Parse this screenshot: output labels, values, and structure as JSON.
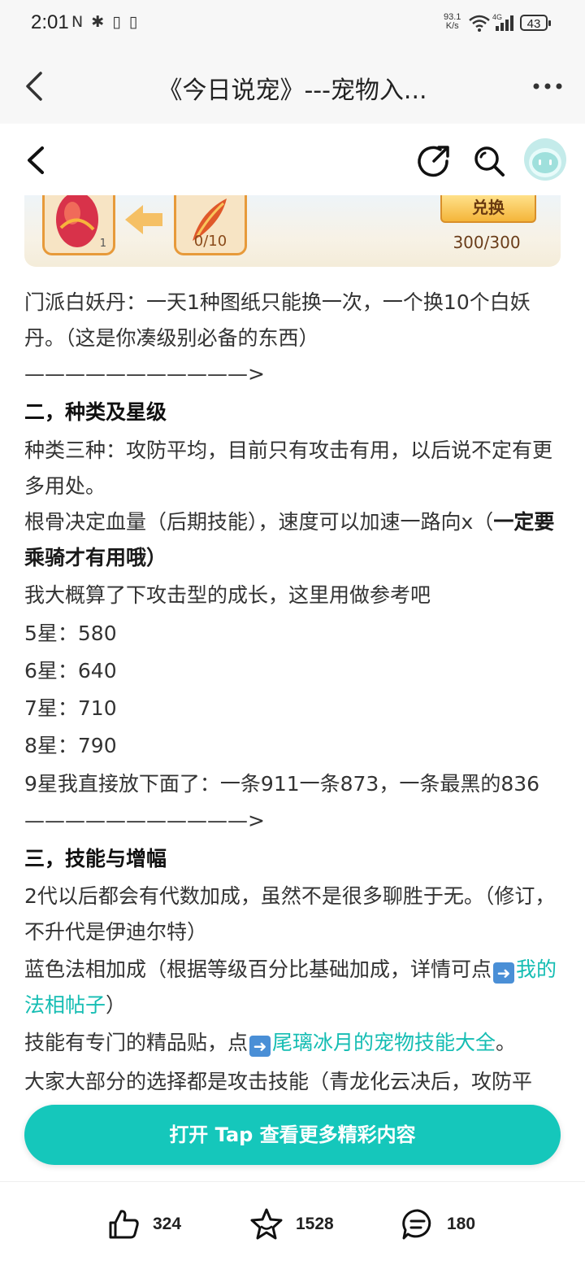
{
  "status_bar": {
    "time": "2:01",
    "left_icons": "N ✱ ▯ ▯",
    "speed_value": "93.1",
    "speed_unit": "K/s",
    "network": "4G",
    "battery": "43"
  },
  "title_bar": {
    "title": "《今日说宠》---宠物入..."
  },
  "banner": {
    "slot1_count": "1",
    "slot2_fraction": "0/10",
    "exchange_label": "兑换",
    "exchange_count": "300/300"
  },
  "article": {
    "p1": "门派白妖丹：一天1种图纸只能换一次，一个换10个白妖丹。（这是你凑级别必备的东西）",
    "divider1": "———————————>",
    "h2": "二，种类及星级",
    "p2": "种类三种：攻防平均，目前只有攻击有用，以后说不定有更多用处。",
    "p3_a": "根骨决定血量（后期技能），速度可以加速一路向x（",
    "p3_b": "一定要乘骑才有用哦",
    "p3_c": "）",
    "p4": "我大概算了下攻击型的成长，这里用做参考吧",
    "star5": "5星：580",
    "star6": "6星：640",
    "star7": "7星：710",
    "star8": "8星：790",
    "star9": "9星我直接放下面了：一条911一条873，一条最黑的836",
    "divider2": "———————————>",
    "h3": "三，技能与增幅",
    "p5": "2代以后都会有代数加成，虽然不是很多聊胜于无。（修订，不升代是伊迪尔特）",
    "p6_a": "蓝色法相加成（根据等级百分比基础加成，详情可点",
    "p6_link": "我的法相帖子",
    "p6_c": "）",
    "p7_a": "技能有专门的精品贴，点",
    "p7_link": "尾璃冰月的宠物技能大全",
    "p7_c": "。",
    "p8": "大家大部分的选择都是攻击技能（青龙化云决后，攻防平"
  },
  "cta": {
    "label": "打开 Tap 查看更多精彩内容"
  },
  "bottom_bar": {
    "likes": "324",
    "favorites": "1528",
    "comments": "180"
  },
  "colors": {
    "accent": "#15c7bb",
    "link": "#15bdb3"
  }
}
